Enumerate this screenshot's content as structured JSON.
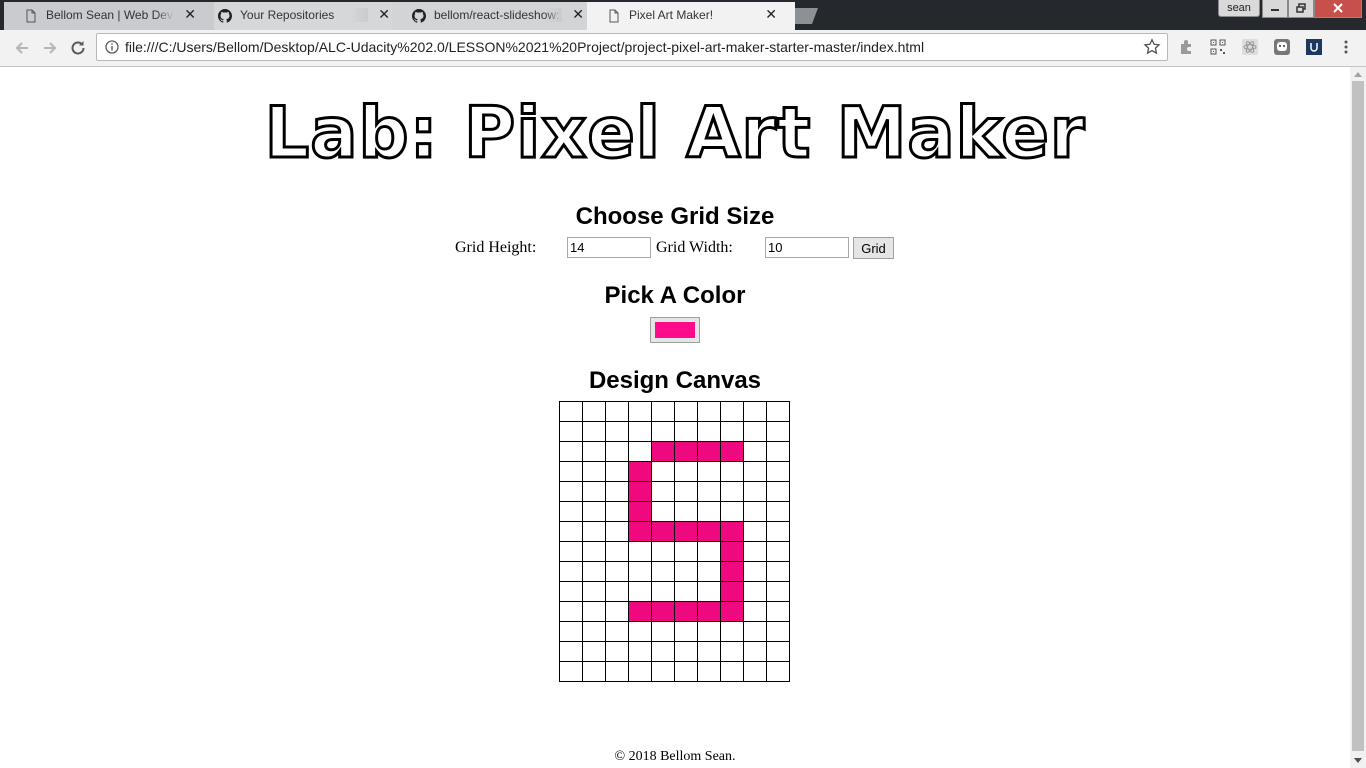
{
  "browser": {
    "tabs": [
      {
        "title": "Bellom Sean | Web Deve",
        "icon": "page-icon",
        "close": "✕"
      },
      {
        "title": "Your Repositories",
        "icon": "github-icon",
        "close": "✕"
      },
      {
        "title": "bellom/react-slideshow: A",
        "icon": "github-icon",
        "close": "✕"
      },
      {
        "title": "Pixel Art Maker!",
        "icon": "page-icon",
        "close": "✕",
        "active": true
      }
    ],
    "profile": "sean",
    "url": "file:///C:/Users/Bellom/Desktop/ALC-Udacity%202.0/LESSON%2021%20Project/project-pixel-art-maker-starter-master/index.html"
  },
  "page": {
    "title": "Lab: Pixel Art Maker",
    "grid_heading": "Choose Grid Size",
    "height_label": "Grid Height:",
    "height_value": "14",
    "width_label": "Grid Width:",
    "width_value": "10",
    "grid_button": "Grid",
    "color_heading": "Pick A Color",
    "selected_color": "#ff0a8a",
    "canvas_heading": "Design Canvas",
    "footer": "© 2018 Bellom Sean."
  },
  "canvas": {
    "rows": 14,
    "cols": 10,
    "paint_color": "#f0087f",
    "painted_cells": [
      [
        2,
        4
      ],
      [
        2,
        5
      ],
      [
        2,
        6
      ],
      [
        2,
        7
      ],
      [
        3,
        3
      ],
      [
        4,
        3
      ],
      [
        5,
        3
      ],
      [
        6,
        3
      ],
      [
        6,
        4
      ],
      [
        6,
        5
      ],
      [
        6,
        6
      ],
      [
        6,
        7
      ],
      [
        7,
        7
      ],
      [
        8,
        7
      ],
      [
        9,
        7
      ],
      [
        10,
        3
      ],
      [
        10,
        4
      ],
      [
        10,
        5
      ],
      [
        10,
        6
      ],
      [
        10,
        7
      ]
    ]
  }
}
